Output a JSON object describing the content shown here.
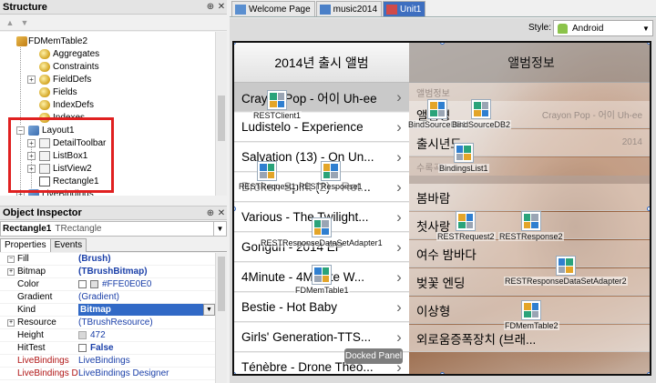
{
  "structure": {
    "title": "Structure",
    "tree": [
      {
        "label": "FDMemTable2",
        "level": 1,
        "expander": "−",
        "icon": "comp"
      },
      {
        "label": "Aggregates",
        "level": 2,
        "expander": "",
        "icon": "prop"
      },
      {
        "label": "Constraints",
        "level": 2,
        "expander": "",
        "icon": "prop"
      },
      {
        "label": "FieldDefs",
        "level": 2,
        "expander": "+",
        "icon": "prop"
      },
      {
        "label": "Fields",
        "level": 2,
        "expander": "",
        "icon": "prop"
      },
      {
        "label": "IndexDefs",
        "level": 2,
        "expander": "",
        "icon": "prop"
      },
      {
        "label": "Indexes",
        "level": 2,
        "expander": "",
        "icon": "prop"
      },
      {
        "label": "Layout1",
        "level": 1,
        "expander": "−",
        "icon": "group"
      },
      {
        "label": "DetailToolbar",
        "level": 2,
        "expander": "+",
        "icon": "item"
      },
      {
        "label": "ListBox1",
        "level": 2,
        "expander": "+",
        "icon": "item"
      },
      {
        "label": "ListView2",
        "level": 2,
        "expander": "+",
        "icon": "item"
      },
      {
        "label": "Rectangle1",
        "level": 2,
        "expander": "",
        "icon": "rect"
      },
      {
        "label": "LiveBindings",
        "level": 1,
        "expander": "+",
        "icon": "group"
      }
    ]
  },
  "inspector": {
    "title": "Object Inspector",
    "selected_name": "Rectangle1",
    "selected_class": "TRectangle",
    "tabs": [
      "Properties",
      "Events"
    ],
    "rows": [
      {
        "name": "Fill",
        "expander": "−",
        "value": "(Brush)",
        "style": "blue-bold",
        "lead": "",
        "red": false
      },
      {
        "name": "Bitmap",
        "expander": "+",
        "value": "(TBrushBitmap)",
        "style": "blue-bold",
        "lead": "",
        "red": false,
        "indent": true
      },
      {
        "name": "Color",
        "expander": "",
        "value": "#FFE0E0E0",
        "style": "blue",
        "lead": "swatch",
        "red": false,
        "indent": true
      },
      {
        "name": "Gradient",
        "expander": "",
        "value": "(Gradient)",
        "style": "blue",
        "lead": "",
        "red": false,
        "indent": true
      },
      {
        "name": "Kind",
        "expander": "",
        "value": "Bitmap",
        "style": "selected",
        "lead": "",
        "red": false,
        "indent": true
      },
      {
        "name": "Resource",
        "expander": "+",
        "value": "(TBrushResource)",
        "style": "blue",
        "lead": "",
        "red": false,
        "indent": true
      },
      {
        "name": "Height",
        "expander": "",
        "value": "472",
        "style": "blue",
        "lead": "icon",
        "red": false
      },
      {
        "name": "HitTest",
        "expander": "",
        "value": "False",
        "style": "blue-bold",
        "lead": "check",
        "red": false
      },
      {
        "name": "LiveBindings",
        "expander": "",
        "value": "LiveBindings",
        "style": "blue",
        "lead": "",
        "red": true
      },
      {
        "name": "LiveBindings Desig",
        "expander": "",
        "value": "LiveBindings Designer",
        "style": "blue",
        "lead": "",
        "red": true
      }
    ]
  },
  "editor_tabs": [
    {
      "label": "Welcome Page",
      "active": false
    },
    {
      "label": "music2014",
      "active": false
    },
    {
      "label": "Unit1",
      "active": true
    }
  ],
  "style_bar": {
    "label": "Style:",
    "value": "Android"
  },
  "form": {
    "left_header": "2014년 출시 앨범",
    "right_header": "앨범정보",
    "albums": [
      "Crayon Pop - 어이 Uh-ee",
      "Ludistelo - Experience",
      "Salvation (13) - On Un...",
      "Broken Spirit (2) - Rot...",
      "Various - The Twilight...",
      "Gonguri - 2014 EP",
      "4Minute - 4Minute W...",
      "Bestie - Hot Baby",
      "Girls' Generation-TTS...",
      "Ténèbre - Drone Theo..."
    ],
    "detail_section": "앨범정보",
    "detail_rows": [
      {
        "label": "앨범명",
        "value": "Crayon Pop - 어이 Uh-ee"
      },
      {
        "label": "출시년도",
        "value": "2014"
      }
    ],
    "tracks_section": "수록곡",
    "tracks": [
      "봄바람",
      "첫사랑",
      "여수 밤바다",
      "벚꽃 엔딩",
      "이상형",
      "외로움증폭장치 (브래..."
    ],
    "docked_label": "Docked Panel"
  },
  "components": [
    {
      "id": "restclient1",
      "label": "RESTClient1"
    },
    {
      "id": "restrequest1",
      "label": "RESTRequest1"
    },
    {
      "id": "restresponse1",
      "label": "RESTResponse1"
    },
    {
      "id": "restresponsedataset1",
      "label": "RESTResponseDataSetAdapter1"
    },
    {
      "id": "fdmemtable1",
      "label": "FDMemTable1"
    },
    {
      "id": "bindsourcedb1",
      "label": "BindSourceDB1"
    },
    {
      "id": "bindsourcedb2",
      "label": "BindSourceDB2"
    },
    {
      "id": "bindingslist1",
      "label": "BindingsList1"
    },
    {
      "id": "restrequest2",
      "label": "RESTRequest2"
    },
    {
      "id": "restresponse2",
      "label": "RESTResponse2"
    },
    {
      "id": "restresponsedataset2",
      "label": "RESTResponseDataSetAdapter2"
    },
    {
      "id": "fdmemtable2",
      "label": "FDMemTable2"
    }
  ]
}
